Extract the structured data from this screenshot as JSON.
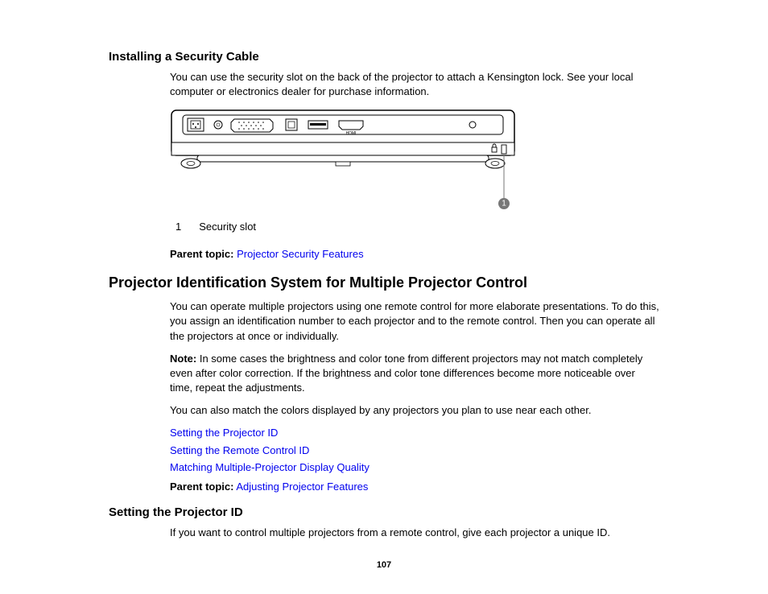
{
  "section1": {
    "heading": "Installing a Security Cable",
    "intro": "You can use the security slot on the back of the projector to attach a Kensington lock. See your local computer or electronics dealer for purchase information.",
    "callout_num": "1",
    "legend": {
      "num": "1",
      "text": "Security slot"
    },
    "parent_label": "Parent topic:",
    "parent_link": "Projector Security Features"
  },
  "section2": {
    "heading": "Projector Identification System for Multiple Projector Control",
    "p1": "You can operate multiple projectors using one remote control for more elaborate presentations. To do this, you assign an identification number to each projector and to the remote control. Then you can operate all the projectors at once or individually.",
    "note_label": "Note:",
    "note_body": "In some cases the brightness and color tone from different projectors may not match completely even after color correction. If the brightness and color tone differences become more noticeable over time, repeat the adjustments.",
    "p3": "You can also match the colors displayed by any projectors you plan to use near each other.",
    "links": [
      "Setting the Projector ID",
      "Setting the Remote Control ID",
      "Matching Multiple-Projector Display Quality"
    ],
    "parent_label": "Parent topic:",
    "parent_link": "Adjusting Projector Features"
  },
  "section3": {
    "heading": "Setting the Projector ID",
    "p1": "If you want to control multiple projectors from a remote control, give each projector a unique ID."
  },
  "page_number": "107"
}
